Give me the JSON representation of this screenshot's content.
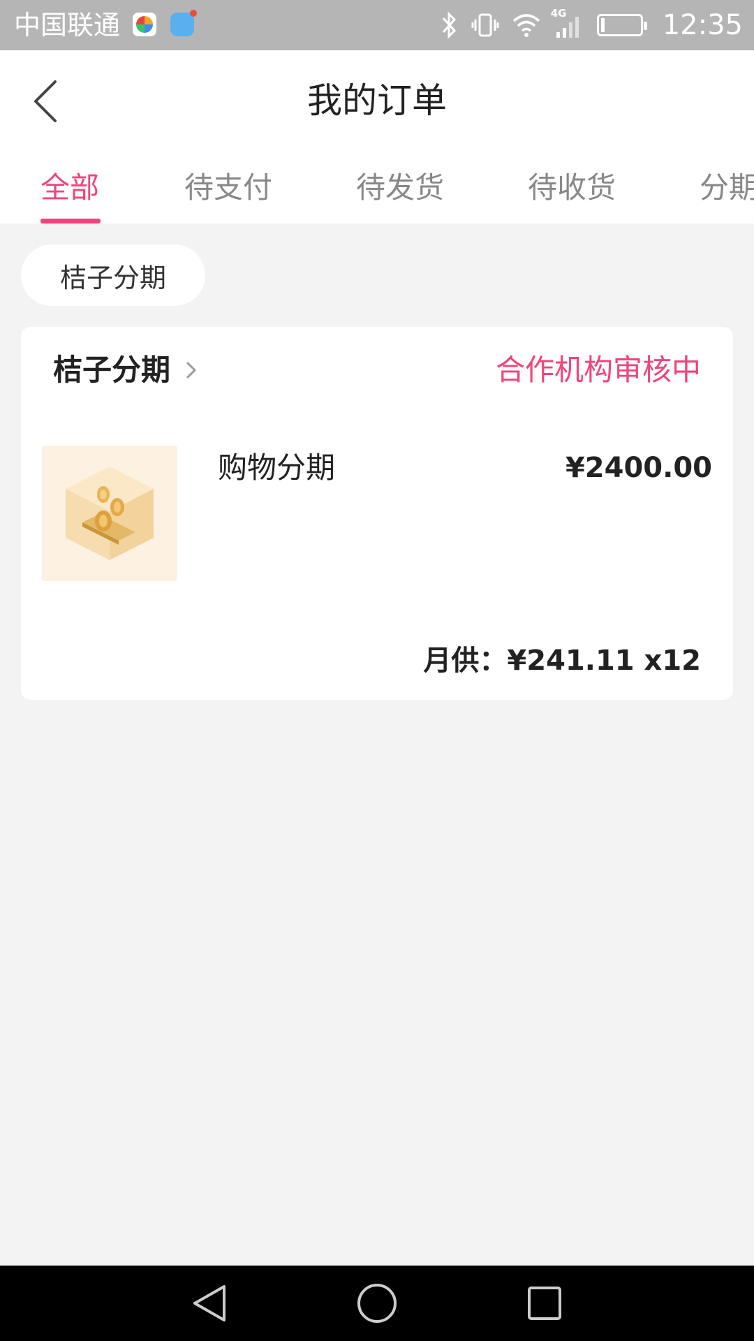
{
  "status_bar": {
    "carrier": "中国联通",
    "network": "4G",
    "time": "12:35",
    "battery_level": 0.1,
    "icons": [
      "app-icon",
      "message-icon",
      "bluetooth-icon",
      "vibrate-icon",
      "wifi-icon",
      "signal-icon",
      "battery-icon"
    ]
  },
  "nav": {
    "title": "我的订单",
    "back_icon": "chevron-left-icon"
  },
  "tabs": [
    {
      "label": "全部",
      "active": true
    },
    {
      "label": "待支付",
      "active": false
    },
    {
      "label": "待发货",
      "active": false
    },
    {
      "label": "待收货",
      "active": false
    },
    {
      "label": "分期",
      "active": false
    }
  ],
  "filter_chip": {
    "label": "桔子分期"
  },
  "order": {
    "merchant": "桔子分期",
    "status": "合作机构审核中",
    "product_name": "购物分期",
    "price": "¥2400.00",
    "monthly_label": "月供：",
    "monthly_amount": "¥241.11 x12"
  },
  "colors": {
    "accent": "#f0457a",
    "status_bar": "#b5b5b5",
    "background": "#f3f3f3"
  }
}
